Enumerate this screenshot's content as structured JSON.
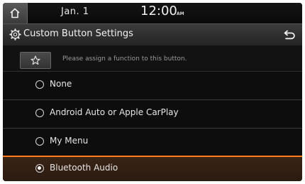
{
  "status": {
    "date": "Jan. 1",
    "time": "12:00",
    "ampm": "AM"
  },
  "header": {
    "title": "Custom Button Settings"
  },
  "hint": {
    "text": "Please assign a function to this button."
  },
  "options": [
    {
      "label": "None",
      "selected": false
    },
    {
      "label": "Android Auto or Apple CarPlay",
      "selected": false
    },
    {
      "label": "My Menu",
      "selected": false
    },
    {
      "label": "Bluetooth Audio",
      "selected": true
    }
  ],
  "colors": {
    "selection_accent": "#ff7a1a",
    "background": "#0d0d0d"
  }
}
